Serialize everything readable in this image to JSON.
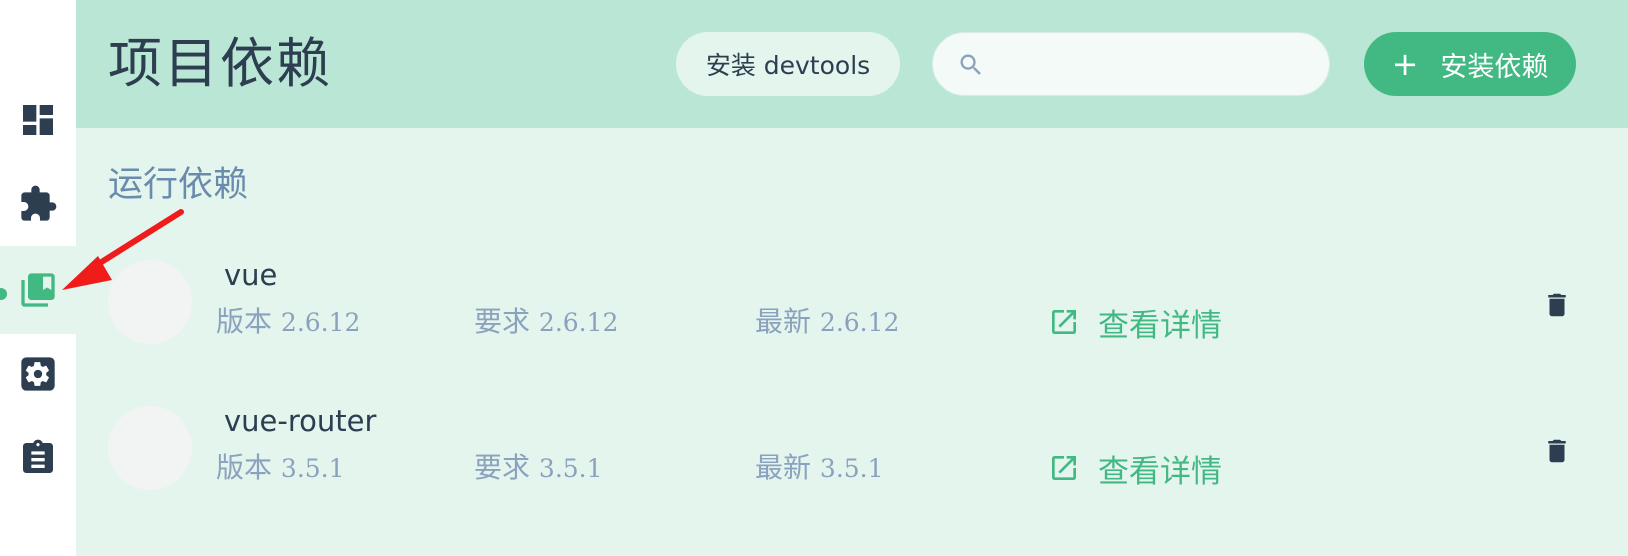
{
  "header": {
    "title": "项目依赖",
    "devtools_label": "安装 devtools",
    "search_placeholder": "",
    "install_label": "安装依赖"
  },
  "sidebar": {
    "items": [
      {
        "icon": "dashboard-icon",
        "active": false
      },
      {
        "icon": "puzzle-icon",
        "active": false
      },
      {
        "icon": "library-books-icon",
        "active": true
      },
      {
        "icon": "settings-icon",
        "active": false
      },
      {
        "icon": "clipboard-icon",
        "active": false
      }
    ]
  },
  "section": {
    "title": "运行依赖"
  },
  "dependencies": [
    {
      "name": "vue",
      "version_label": "版本",
      "version": "2.6.12",
      "required_label": "要求",
      "required": "2.6.12",
      "latest_label": "最新",
      "latest": "2.6.12",
      "details_label": "查看详情"
    },
    {
      "name": "vue-router",
      "version_label": "版本",
      "version": "3.5.1",
      "required_label": "要求",
      "required": "3.5.1",
      "latest_label": "最新",
      "latest": "3.5.1",
      "details_label": "查看详情"
    }
  ],
  "colors": {
    "accent": "#42b983",
    "header_bg": "#bae6d5",
    "content_bg": "#e4f5ee",
    "text_dark": "#2c3e50",
    "text_muted": "#8aa2bd",
    "annotation_arrow": "#f01c1c"
  }
}
